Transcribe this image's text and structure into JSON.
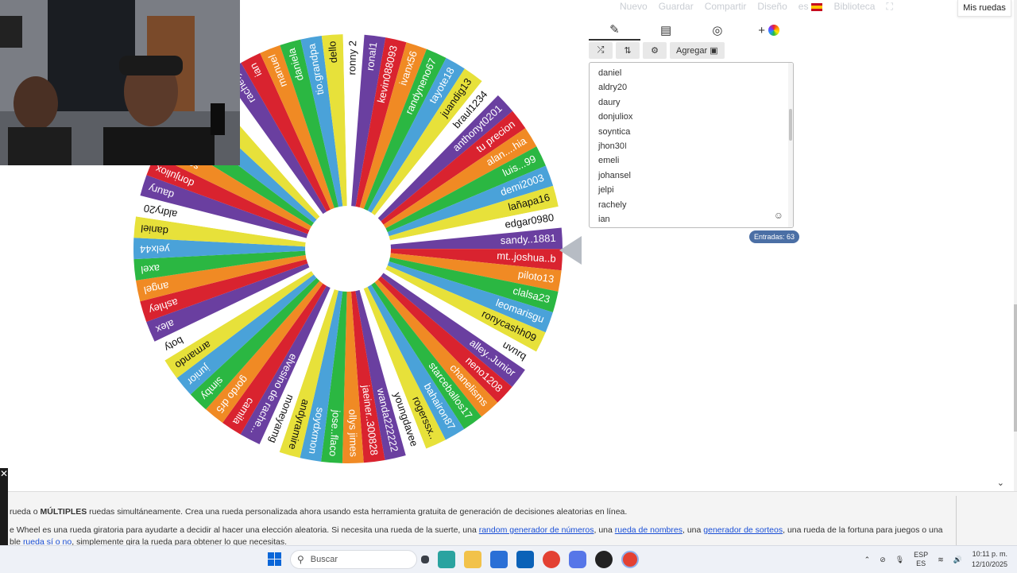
{
  "nav": {
    "items": [
      "Nuevo",
      "Guardar",
      "Compartir",
      "Diseño",
      "es",
      "Biblioteca"
    ],
    "mis_ruedas": "Mis ruedas"
  },
  "toolbar": {
    "tabs": [
      "edit-icon",
      "clipboard-icon",
      "hide-icon",
      "add-wheel-icon"
    ],
    "agregar_label": "Agregar"
  },
  "entries": {
    "items": [
      "daniel",
      "aldry20",
      "daury",
      "donjuliox",
      "soyntica",
      "jhon30",
      "emeli",
      "johansel",
      "jelpi",
      "rachely",
      "ian"
    ],
    "count_label": "Entradas: 63"
  },
  "wheel": {
    "segments": [
      "jhon30",
      "emeli",
      "johansel",
      "jelpi",
      "rachely",
      "ian",
      "manuel",
      "daniela",
      "tio.grandpa",
      "dello",
      "ronny 2",
      "ronal1",
      "kevin088093",
      "ivanx56",
      "randyneno67",
      "tayote18",
      "juandig13",
      "braul1234",
      "anthonyt0201",
      "tu precion",
      "alan....hia",
      "luis...99",
      "demi2003",
      "lañapa16",
      "edgar0980",
      "sandy..1881",
      "mt..joshua..b",
      "piloto13",
      "clalsa23",
      "leomarisgu",
      "ronycashh09",
      "uvnrq",
      "alley..Junior",
      "neno1208",
      "chanelisms",
      "starceballos17",
      "bahairon87",
      "rogerssx..",
      "youngdavee",
      "wanda222222",
      "jaeiner..300828",
      "ollys jimes",
      "jose..flaco",
      "soydxmon",
      "andyramire",
      "moneyamg",
      "elvesino de rache...",
      "camila",
      "gordo dr5",
      "simby",
      "junior",
      "armando",
      "boty",
      "alex",
      "ashley",
      "angel",
      "axel",
      "yelx44",
      "daniel",
      "aldry20",
      "daury",
      "donjuliox",
      "soyntica"
    ],
    "colors": [
      "#e4a9ff",
      "#2bb742",
      "#4aa2d9",
      "#e7e13a",
      "#ffffff",
      "#6a3fa0",
      "#d9232f",
      "#f08a24"
    ]
  },
  "description": {
    "line1_prefix": "rueda o ",
    "line1_bold": "MÚLTIPLES",
    "line1_rest": " ruedas simultáneamente. Crea una rueda personalizada ahora usando esta herramienta gratuita de generación de decisiones aleatorias en línea.",
    "line2_prefix": "e Wheel es una rueda giratoria para ayudarte a decidir al hacer una elección aleatoria. Si necesita una rueda de la suerte, una ",
    "link1": "random generador de números",
    "sep1": ", una ",
    "link2": "rueda de nombres",
    "sep2": ", una ",
    "link3": "generador de sorteos",
    "line2_suffix": ", una rueda de la fortuna para juegos o una",
    "line3_prefix": "ble ",
    "link4": "rueda sí o no",
    "line3_suffix": ", simplemente gira la rueda para obtener lo que necesitas."
  },
  "taskbar": {
    "search_placeholder": "Buscar",
    "lang_top": "ESP",
    "lang_bottom": "ES",
    "time": "10:11 p. m.",
    "date": "12/10/2025"
  }
}
